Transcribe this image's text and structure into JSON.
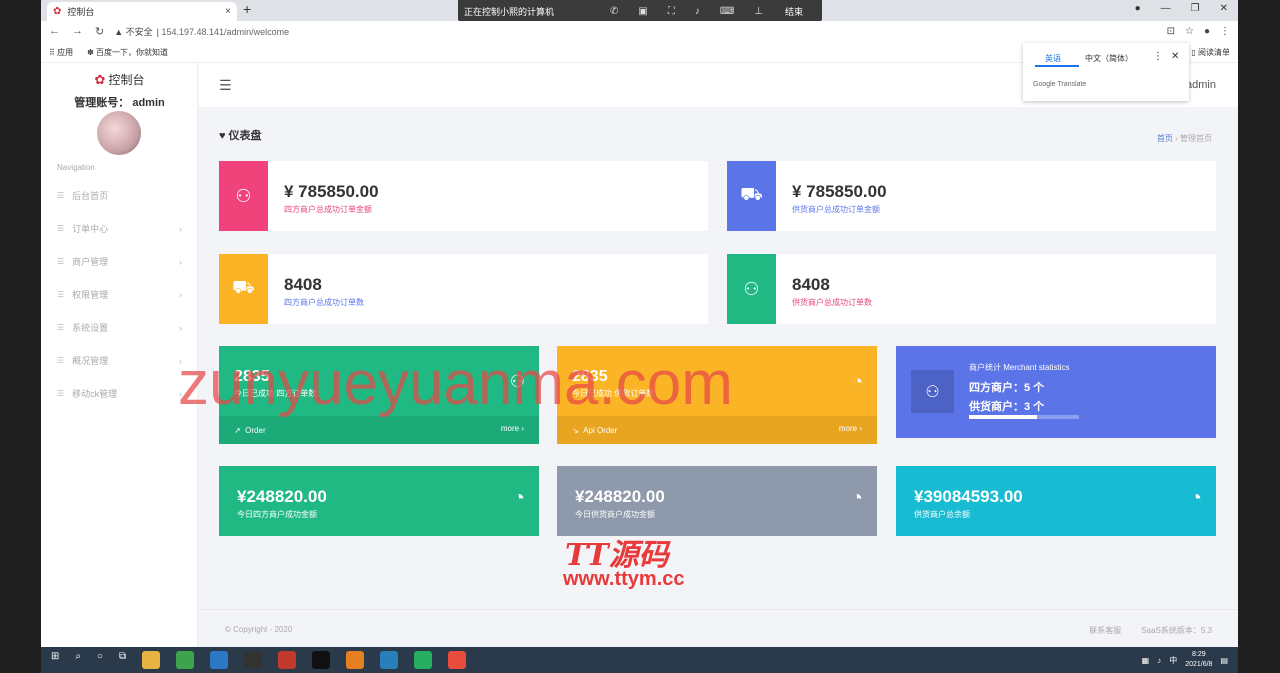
{
  "browser": {
    "tab_title": "控制台",
    "tab_close": "×",
    "new_tab": "+",
    "insecure_label": "不安全",
    "url": "154.197.48.141/admin/welcome",
    "bookmarks": [
      "应用",
      "百度一下，你就知道"
    ],
    "reading_list": "阅读清单"
  },
  "remote_bar": {
    "title": "正在控制小熙的计算机",
    "end_label": "结束"
  },
  "translate": {
    "lang_source": "英语",
    "lang_target": "中文（简体）",
    "provider": "Google Translate"
  },
  "sidebar": {
    "brand": "控制台",
    "account_label": "管理账号： admin",
    "nav_title": "Navigation",
    "items": [
      {
        "label": "后台首页",
        "has_children": false
      },
      {
        "label": "订单中心",
        "has_children": true
      },
      {
        "label": "商户管理",
        "has_children": true
      },
      {
        "label": "权限管理",
        "has_children": true
      },
      {
        "label": "系统设置",
        "has_children": true
      },
      {
        "label": "概况管理",
        "has_children": true
      },
      {
        "label": "移动ck管理",
        "has_children": true
      }
    ]
  },
  "topbar": {
    "user": "admin"
  },
  "page": {
    "heading": "仪表盘",
    "breadcrumb_home": "首页",
    "breadcrumb_sep": "›",
    "breadcrumb_current": "管理首页"
  },
  "stats": [
    {
      "value": "¥ 785850.00",
      "label": "四方商户总成功订单金额",
      "color": "#f0437c",
      "label_color": "#e8457a"
    },
    {
      "value": "¥ 785850.00",
      "label": "供货商户总成功订单金额",
      "color": "#5b74e8",
      "label_color": "#5b74e8"
    },
    {
      "value": "8408",
      "label": "四方商户总成功订单数",
      "color": "#fbb425",
      "label_color": "#5b74e8"
    },
    {
      "value": "8408",
      "label": "供货商户总成功订单数",
      "color": "#20b984",
      "label_color": "#e8457a"
    }
  ],
  "order_cards": [
    {
      "value": "2835",
      "label": "今日已成功 四方订单数",
      "footer": "Order",
      "more": "more ›",
      "color": "#20b984"
    },
    {
      "value": "2835",
      "label": "今日已成功 供货订单数",
      "footer": "Api Order",
      "more": "more ›",
      "color": "#fbb425"
    }
  ],
  "merchant": {
    "title": "商户统计 Merchant statistics",
    "line1": "四方商户：5 个",
    "line2": "供货商户：3 个",
    "progress": 0.62
  },
  "amount_cards": [
    {
      "value": "¥248820.00",
      "label": "今日四方商户成功金额",
      "color": "#20b984"
    },
    {
      "value": "¥248820.00",
      "label": "今日供货商户成功金额",
      "color": "#8e99ab"
    },
    {
      "value": "¥39084593.00",
      "label": "供货商户总余额",
      "color": "#18bcd2"
    }
  ],
  "footer": {
    "copyright": "© Copyright - 2020",
    "contact": "联系客服",
    "version": "SaaS系统版本：5.3"
  },
  "watermarks": {
    "big": "zunyueyuanma.com",
    "logo": "TT源码",
    "url": "www.ttym.cc"
  },
  "taskbar": {
    "time": "8:29",
    "date": "2021/6/8",
    "ime": "中"
  }
}
